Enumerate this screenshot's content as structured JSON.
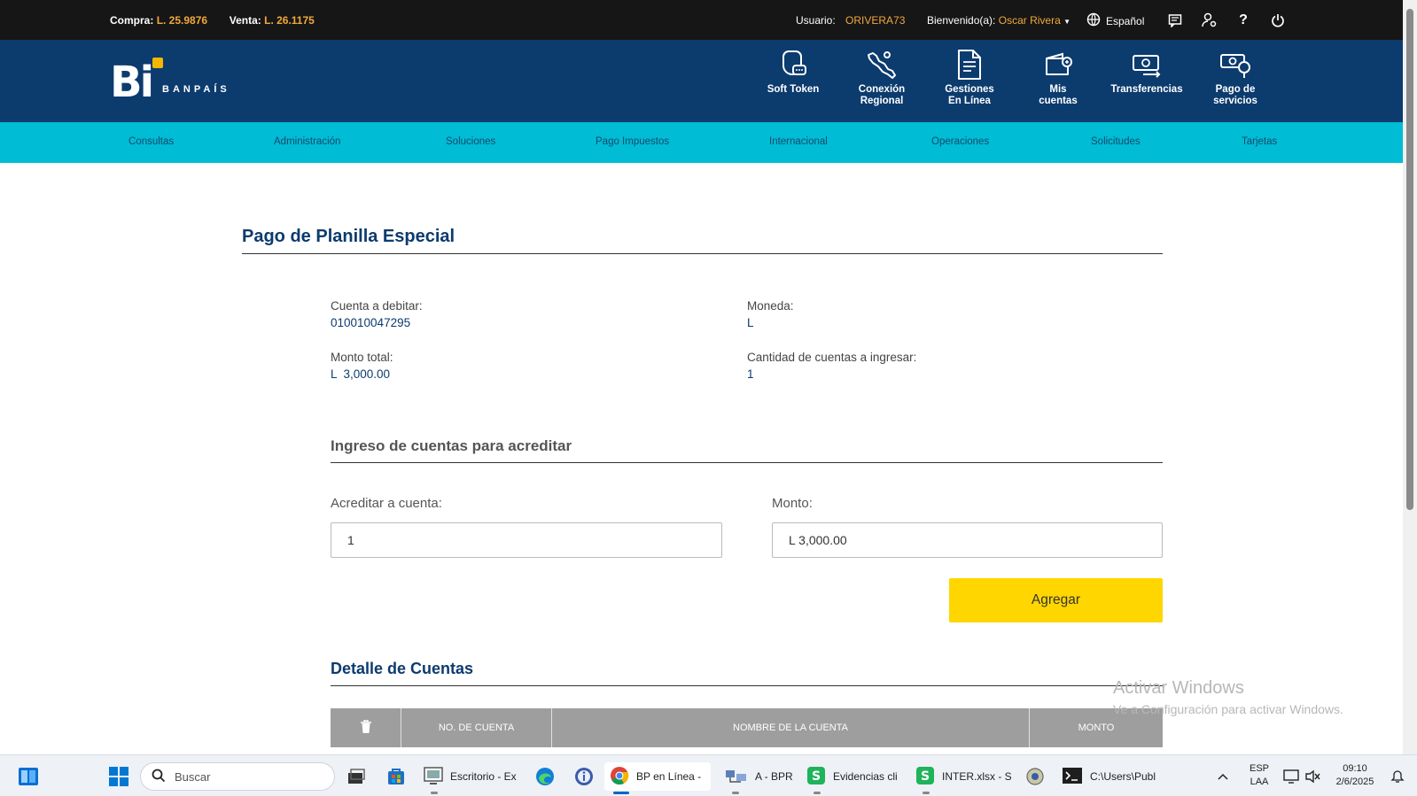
{
  "topbar": {
    "compra_label": "Compra:",
    "compra_value": "L. 25.9876",
    "venta_label": "Venta:",
    "venta_value": "L. 26.1175",
    "usuario_label": "Usuario:",
    "usuario_value": "ORIVERA73",
    "bienvenido_label": "Bienvenido(a):",
    "bienvenido_value": "Oscar Rivera",
    "language": "Español"
  },
  "header": {
    "logo_text": "Bi",
    "brand": "BANPAÍS",
    "shortcuts": [
      {
        "line1": "Soft Token",
        "line2": ""
      },
      {
        "line1": "Conexión",
        "line2": "Regional"
      },
      {
        "line1": "Gestiones",
        "line2": "En Línea"
      },
      {
        "line1": "Mis",
        "line2": "cuentas"
      },
      {
        "line1": "Transferencias",
        "line2": ""
      },
      {
        "line1": "Pago de",
        "line2": "servicios"
      }
    ]
  },
  "nav": [
    "Consultas",
    "Administración",
    "Soluciones",
    "Pago Impuestos",
    "Internacional",
    "Operaciones",
    "Solicitudes",
    "Tarjetas"
  ],
  "main": {
    "title": "Pago de Planilla Especial",
    "cuenta_label": "Cuenta a debitar:",
    "cuenta_value": "010010047295",
    "moneda_label": "Moneda:",
    "moneda_value": "L",
    "monto_total_label": "Monto total:",
    "monto_total_value": "L  3,000.00",
    "cantidad_label": "Cantidad de cuentas a ingresar:",
    "cantidad_value": "1",
    "ingreso_title": "Ingreso de cuentas para acreditar",
    "acreditar_label": "Acreditar a cuenta:",
    "acreditar_value": "1",
    "monto_label": "Monto:",
    "monto_value": "L 3,000.00",
    "agregar_label": "Agregar",
    "detalle_title": "Detalle de Cuentas",
    "table_headers": [
      "NO. DE CUENTA",
      "NOMBRE DE LA CUENTA",
      "MONTO"
    ]
  },
  "watermark": {
    "line1": "Activar Windows",
    "line2": "Ve a Configuración para activar Windows."
  },
  "taskbar": {
    "search_placeholder": "Buscar",
    "apps": [
      "Escritorio - Ex",
      "BP en Línea -",
      "A - BPR",
      "Evidencias cli",
      "INTER.xlsx - S",
      "C:\\Users\\Publ"
    ],
    "lang1": "ESP",
    "lang2": "LAA",
    "time": "09:10",
    "date": "2/6/2025"
  }
}
